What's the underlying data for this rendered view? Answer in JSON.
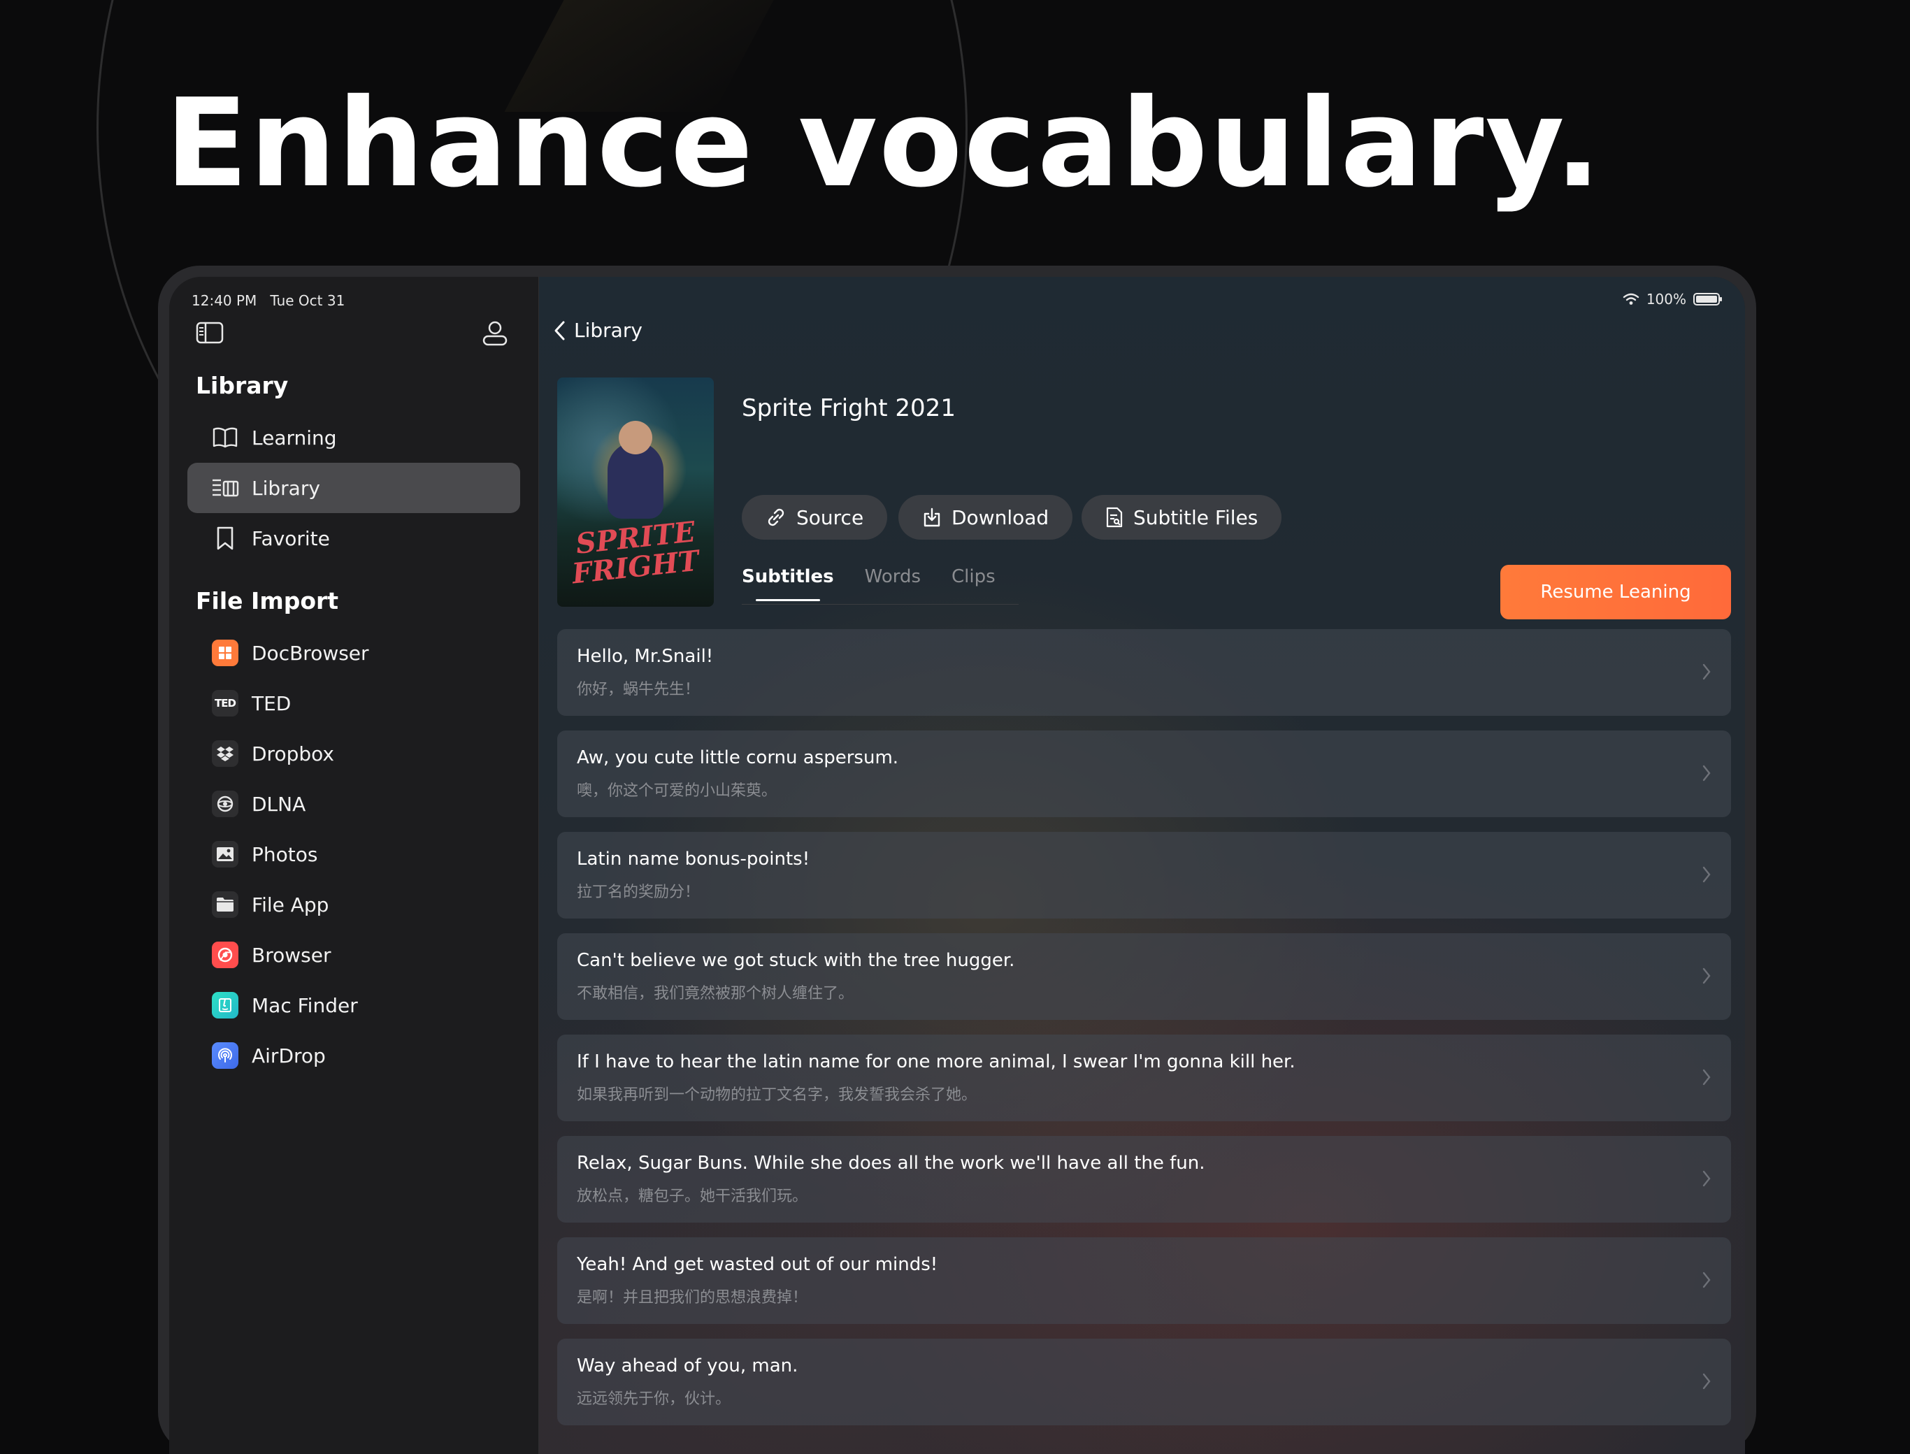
{
  "headline": "Enhance vocabulary.",
  "status_bar": {
    "time": "12:40 PM",
    "date": "Tue Oct 31",
    "battery": "100%"
  },
  "sidebar": {
    "library_heading": "Library",
    "library_items": [
      {
        "label": "Learning",
        "icon": "book-icon"
      },
      {
        "label": "Library",
        "icon": "library-list-icon",
        "active": true
      },
      {
        "label": "Favorite",
        "icon": "bookmark-icon"
      }
    ],
    "file_import_heading": "File Import",
    "import_items": [
      {
        "label": "DocBrowser",
        "icon": "docbrowser-icon"
      },
      {
        "label": "TED",
        "icon": "ted-icon",
        "icon_text": "TED"
      },
      {
        "label": "Dropbox",
        "icon": "dropbox-icon"
      },
      {
        "label": "DLNA",
        "icon": "dlna-icon"
      },
      {
        "label": "Photos",
        "icon": "photos-icon"
      },
      {
        "label": "File App",
        "icon": "folder-icon"
      },
      {
        "label": "Browser",
        "icon": "browser-icon"
      },
      {
        "label": "Mac Finder",
        "icon": "mac-finder-icon"
      },
      {
        "label": "AirDrop",
        "icon": "airdrop-icon"
      }
    ]
  },
  "main": {
    "back_label": "Library",
    "title": "Sprite Fright 2021",
    "poster_title": [
      "SPRITE",
      "FRIGHT"
    ],
    "actions": {
      "source": "Source",
      "download": "Download",
      "subtitle_files": "Subtitle Files"
    },
    "tabs": [
      {
        "label": "Subtitles",
        "active": true
      },
      {
        "label": "Words"
      },
      {
        "label": "Clips"
      }
    ],
    "resume_label": "Resume Leaning",
    "subtitles": [
      {
        "en": "Hello, Mr.Snail!",
        "zh": "你好，蜗牛先生！"
      },
      {
        "en": "Aw, you cute little cornu aspersum.",
        "zh": "噢，你这个可爱的小山茱萸。"
      },
      {
        "en": "Latin name bonus-points!",
        "zh": "拉丁名的奖励分！"
      },
      {
        "en": "Can't believe we got stuck with the tree hugger.",
        "zh": "不敢相信，我们竟然被那个树人缠住了。"
      },
      {
        "en": "If I have to hear the latin name for one more animal, I swear I'm gonna kill her.",
        "zh": "如果我再听到一个动物的拉丁文名字，我发誓我会杀了她。"
      },
      {
        "en": "Relax, Sugar Buns. While she does all the work we'll have all the fun.",
        "zh": "放松点，糖包子。她干活我们玩。"
      },
      {
        "en": "Yeah! And get wasted out of our minds!",
        "zh": "是啊！并且把我们的思想浪费掉！"
      },
      {
        "en": "Way ahead of you, man.",
        "zh": "远远领先于你，伙计。"
      }
    ]
  },
  "colors": {
    "accent": "#ff713a",
    "sidebar_bg": "#1c1c1e",
    "active_item": "#4a4a4d"
  }
}
